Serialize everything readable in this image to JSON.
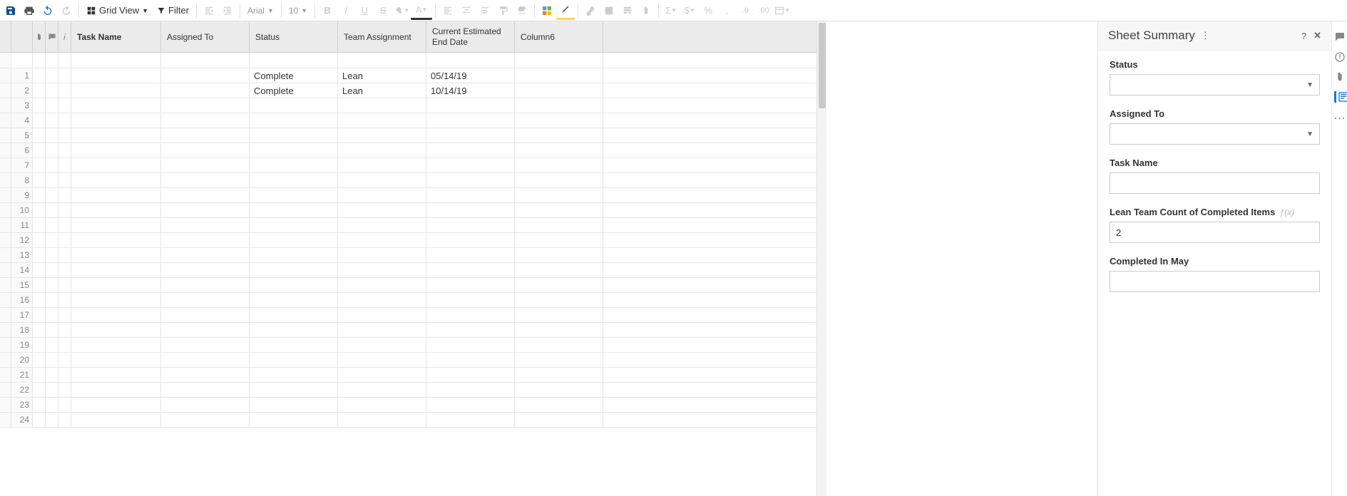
{
  "toolbar": {
    "grid_view_label": "Grid View",
    "filter_label": "Filter",
    "font_name": "Arial",
    "font_size": "10"
  },
  "columns": {
    "task_name": "Task Name",
    "assigned_to": "Assigned To",
    "status": "Status",
    "team_assignment": "Team Assignment",
    "end_date": "Current Estimated End Date",
    "column6": "Column6"
  },
  "rows": [
    {
      "num": "1",
      "task": "",
      "assigned": "",
      "status": "Complete",
      "team": "Lean",
      "date": "05/14/19",
      "col6": ""
    },
    {
      "num": "2",
      "task": "",
      "assigned": "",
      "status": "Complete",
      "team": "Lean",
      "date": "10/14/19",
      "col6": ""
    },
    {
      "num": "3"
    },
    {
      "num": "4"
    },
    {
      "num": "5"
    },
    {
      "num": "6"
    },
    {
      "num": "7"
    },
    {
      "num": "8"
    },
    {
      "num": "9"
    },
    {
      "num": "10"
    },
    {
      "num": "11"
    },
    {
      "num": "12"
    },
    {
      "num": "13"
    },
    {
      "num": "14"
    },
    {
      "num": "15"
    },
    {
      "num": "16"
    },
    {
      "num": "17"
    },
    {
      "num": "18"
    },
    {
      "num": "19"
    },
    {
      "num": "20"
    },
    {
      "num": "21"
    },
    {
      "num": "22"
    },
    {
      "num": "23"
    },
    {
      "num": "24"
    }
  ],
  "summary": {
    "title": "Sheet Summary",
    "fields": {
      "status_label": "Status",
      "status_value": "",
      "assigned_label": "Assigned To",
      "assigned_value": "",
      "task_label": "Task Name",
      "task_value": "",
      "lean_count_label": "Lean Team Count of Completed Items",
      "lean_count_value": "2",
      "completed_may_label": "Completed In May",
      "completed_may_value": ""
    }
  }
}
